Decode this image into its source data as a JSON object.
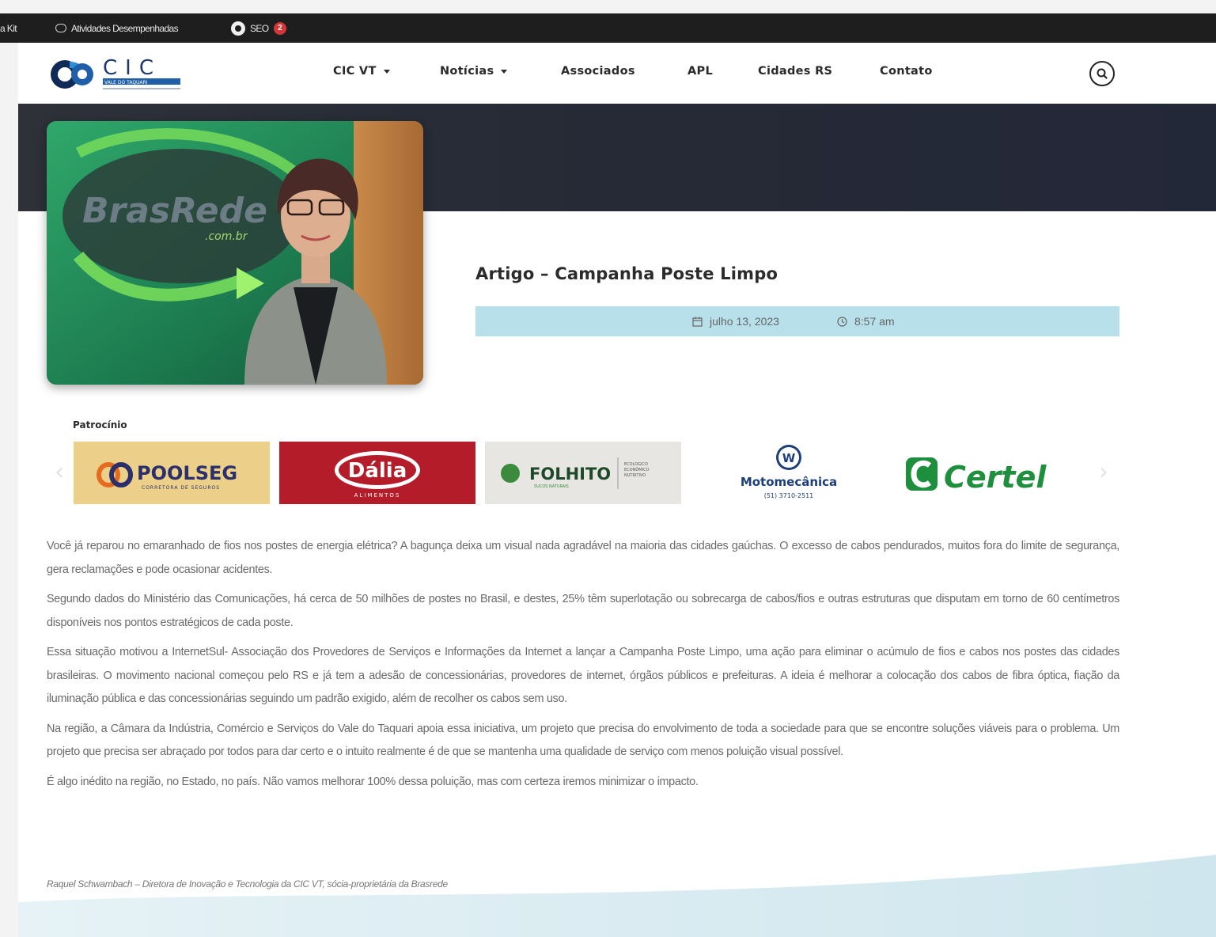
{
  "admin_bar": {
    "kit_label": "a Kit",
    "activities_label": "Atividades Desempenhadas",
    "seo_label": "SEO",
    "seo_count": "2"
  },
  "header": {
    "logo_text": "CIC",
    "logo_subtitle": "VALE DO TAQUARI",
    "nav": [
      {
        "label": "CIC VT",
        "dropdown": true
      },
      {
        "label": "Notícias",
        "dropdown": true
      },
      {
        "label": "Associados",
        "dropdown": false
      },
      {
        "label": "APL",
        "dropdown": false
      },
      {
        "label": "Cidades RS",
        "dropdown": false
      },
      {
        "label": "Contato",
        "dropdown": false
      }
    ]
  },
  "hero": {
    "photo_sign_text": "BrasRede",
    "photo_sign_sub": ".com.br"
  },
  "article": {
    "title": "Artigo – Campanha Poste Limpo",
    "date": "julho 13, 2023",
    "time": "8:57 am",
    "paragraphs": [
      "Você já reparou no emaranhado de fios nos postes de energia elétrica? A bagunça deixa um visual nada agradável na maioria das cidades gaúchas. O excesso de cabos pendurados, muitos fora do limite de segurança, gera reclamações e pode ocasionar acidentes.",
      "Segundo dados do Ministério das Comunicações, há cerca de 50 milhões de postes no Brasil, e destes, 25% têm superlotação ou sobrecarga de cabos/fios e outras estruturas que disputam em torno de 60 centímetros disponíveis nos pontos estratégicos de cada poste.",
      "Essa situação motivou a InternetSul- Associação dos Provedores de Serviços e Informações da Internet a lançar a Campanha Poste Limpo, uma ação para eliminar o acúmulo de fios e cabos nos postes das cidades brasileiras. O movimento nacional começou pelo RS e já tem a adesão de concessionárias, provedores de internet, órgãos públicos e prefeituras. A ideia é melhorar a colocação dos cabos de fibra óptica, fiação da iluminação pública e das concessionárias seguindo um padrão exigido, além de recolher os cabos sem uso.",
      " Na região, a Câmara da Indústria, Comércio e Serviços do Vale do Taquari apoia essa iniciativa, um projeto que precisa do envolvimento de toda a sociedade para que se encontre soluções viáveis para o problema. Um projeto que precisa ser abraçado por todos para dar certo e o intuito realmente é de que se mantenha uma qualidade de serviço com menos poluição visual possível.",
      "É algo inédito na região, no Estado, no país. Não vamos melhorar 100% dessa poluição, mas com certeza iremos minimizar o impacto."
    ],
    "byline": "Raquel Schwambach – Diretora de Inovação e Tecnologia da CIC VT, sócia-proprietária da Brasrede"
  },
  "sponsors": {
    "label": "Patrocínio",
    "items": [
      {
        "name": "POOLSEG",
        "tagline": "CORRETORA DE SEGUROS",
        "bg": "#ecd08a"
      },
      {
        "name": "Dália",
        "tagline": "ALIMENTOS",
        "bg": "#b51c2a"
      },
      {
        "name": "FOLHITO",
        "tagline": "SUCOS NATURAIS",
        "extra": "ECOLÓGICO ECONÔMICO NUTRITIVO",
        "bg": "#e8e6e2"
      },
      {
        "name": "Motomecânica",
        "tagline": "(51) 3710-2511",
        "bg": "#ffffff"
      },
      {
        "name": "Certel",
        "tagline": "",
        "bg": "#ffffff"
      }
    ]
  },
  "colors": {
    "hero_band": "#262a36",
    "meta_bar": "#b7e0ea",
    "admin_bar": "#1e1e1e",
    "logo_blue": "#1f5fa8"
  },
  "icons": {
    "activities": "chat-bubble-icon",
    "seo": "seo-logo-icon",
    "search": "search-icon",
    "date": "calendar-icon",
    "time": "clock-icon"
  }
}
